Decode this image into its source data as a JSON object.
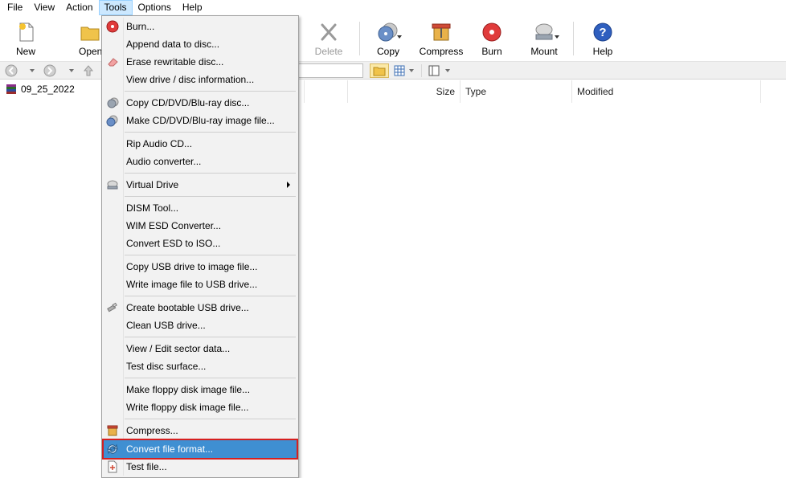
{
  "menubar": {
    "items": [
      {
        "label": "File"
      },
      {
        "label": "View"
      },
      {
        "label": "Action"
      },
      {
        "label": "Tools"
      },
      {
        "label": "Options"
      },
      {
        "label": "Help"
      }
    ]
  },
  "toolbar": {
    "new_label": "New",
    "open_label": "Open",
    "delete_label": "Delete",
    "copy_label": "Copy",
    "compress_label": "Compress",
    "burn_label": "Burn",
    "mount_label": "Mount",
    "help_label": "Help"
  },
  "tree": {
    "root_label": "09_25_2022"
  },
  "list": {
    "columns": {
      "size": "Size",
      "type": "Type",
      "modified": "Modified"
    }
  },
  "tools_menu": {
    "items": [
      {
        "label": "Burn...",
        "icon": "burn-disc-icon"
      },
      {
        "label": "Append data to disc..."
      },
      {
        "label": "Erase rewritable disc...",
        "icon": "eraser-icon"
      },
      {
        "label": "View drive / disc information..."
      },
      {
        "label": "Copy CD/DVD/Blu-ray disc...",
        "icon": "copy-disc-icon"
      },
      {
        "label": "Make CD/DVD/Blu-ray image file...",
        "icon": "make-image-icon"
      },
      {
        "label": "Rip Audio CD..."
      },
      {
        "label": "Audio converter..."
      },
      {
        "label": "Virtual Drive",
        "icon": "virtual-drive-icon",
        "submenu": true
      },
      {
        "label": "DISM Tool..."
      },
      {
        "label": "WIM ESD Converter..."
      },
      {
        "label": "Convert ESD to ISO..."
      },
      {
        "label": "Copy USB drive to image file..."
      },
      {
        "label": "Write image file to USB drive..."
      },
      {
        "label": "Create bootable USB drive...",
        "icon": "usb-icon"
      },
      {
        "label": "Clean USB drive..."
      },
      {
        "label": "View / Edit sector data..."
      },
      {
        "label": "Test disc surface..."
      },
      {
        "label": "Make floppy disk image file..."
      },
      {
        "label": "Write floppy disk image file..."
      },
      {
        "label": "Compress...",
        "icon": "compress-icon"
      },
      {
        "label": "Convert file format...",
        "icon": "convert-icon",
        "highlighted": true
      },
      {
        "label": "Test file...",
        "icon": "test-file-icon"
      }
    ]
  },
  "colors": {
    "highlight": "#3f8fd2",
    "highlight_outline": "#d62020",
    "menu_bg": "#f2f2f2",
    "open_menu_bg": "#cce8ff"
  }
}
